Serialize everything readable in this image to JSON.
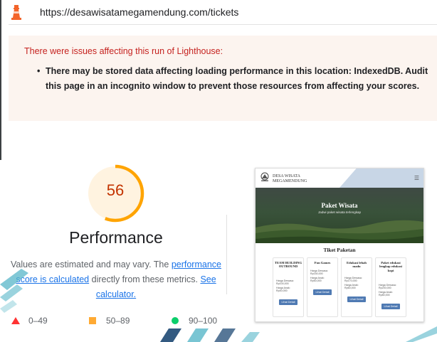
{
  "browser": {
    "url": "https://desawisatamegamendung.com/tickets",
    "logo_icon": "lighthouse-icon"
  },
  "warning": {
    "title": "There were issues affecting this run of Lighthouse:",
    "items": [
      "There may be stored data affecting loading performance in this location: IndexedDB. Audit this page in an incognito window to prevent those resources from affecting your scores."
    ],
    "title_color": "#c5221f",
    "background": "#fcf4ef"
  },
  "performance": {
    "score": "56",
    "score_fraction": 0.56,
    "title": "Performance",
    "desc_before": "Values are estimated and may vary. The ",
    "desc_link": "performance score is calculated",
    "desc_middle": " directly from these metrics. ",
    "desc_link2": "See calculator.",
    "score_color": "#c33300",
    "gauge_color": "#ffa400"
  },
  "legend": {
    "fail": "0–49",
    "average": "50–89",
    "pass": "90–100",
    "fail_color": "#ff3333",
    "average_color": "#ffaa33",
    "pass_color": "#0cce6b"
  },
  "screenshot": {
    "brand_line1": "DESA WISATA",
    "brand_line2": "MEGAMENDUNG",
    "menu_icon": "hamburger-icon",
    "hero_title": "Paket Wisata",
    "hero_subtitle": "Jadwi paket wisata terlengkap",
    "section_title": "Tiket Paketan",
    "cards": [
      {
        "title": "TEAM BUILDING OUTBOUND",
        "price_adult": "Harga Dewasa: Rp100,000",
        "price_child": "Harga Anak: Rp40,000",
        "button": "Lihat Detail"
      },
      {
        "title": "Fun Games",
        "price_adult": "Harga Dewasa: Rp150,000",
        "price_child": "Harga Anak: Rp50,000",
        "button": "Lihat Detail"
      },
      {
        "title": "Edukasi lebah madu",
        "price_adult": "Harga Dewasa: Rp170,000",
        "price_child": "Harga Anak: Rp60,000",
        "button": "Lihat Detail"
      },
      {
        "title": "Paket edukasi lengkap edukasi kopi",
        "price_adult": "Harga Dewasa: Rp200,000",
        "price_child": "Harga Anak: Rp80,000",
        "button": "Lihat Detail"
      }
    ]
  }
}
